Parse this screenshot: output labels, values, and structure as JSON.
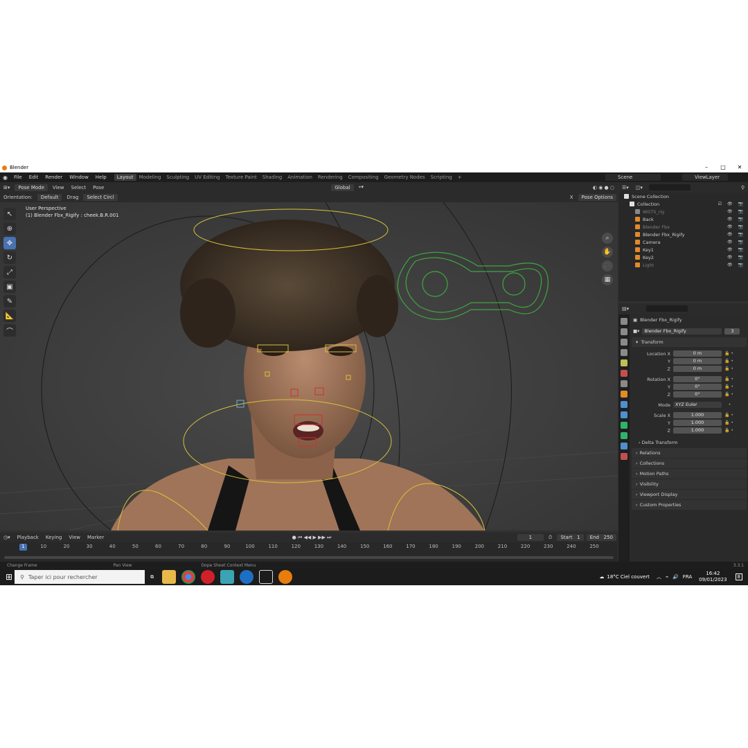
{
  "window": {
    "title": "Blender",
    "version": "3.3.1"
  },
  "menu": [
    "File",
    "Edit",
    "Render",
    "Window",
    "Help"
  ],
  "workspaces": [
    "Layout",
    "Modeling",
    "Sculpting",
    "UV Editing",
    "Texture Paint",
    "Shading",
    "Animation",
    "Rendering",
    "Compositing",
    "Geometry Nodes",
    "Scripting"
  ],
  "active_workspace": "Layout",
  "scene": "Scene",
  "view_layer": "ViewLayer",
  "viewport": {
    "mode": "Pose Mode",
    "view_menu": "View",
    "select_menu": "Select",
    "pose_menu": "Pose",
    "transform_space": "Global",
    "orientation_label": "Orientation:",
    "orientation_value": "Default",
    "drag_label": "Drag",
    "drag_value": "Select Circl",
    "pose_options": "Pose Options",
    "perspective": "User Perspective",
    "active_bone": "(1) Blender Fbx_Rigify : cheek.B.R.001",
    "axis_x": "X"
  },
  "timeline": {
    "playback": "Playback",
    "keying": "Keying",
    "view": "View",
    "marker": "Marker",
    "current_frame": "1",
    "start_label": "Start",
    "start": "1",
    "end_label": "End",
    "end": "250",
    "frame_ticks": [
      "1",
      "10",
      "20",
      "30",
      "40",
      "50",
      "60",
      "70",
      "80",
      "90",
      "100",
      "110",
      "120",
      "130",
      "140",
      "150",
      "160",
      "170",
      "180",
      "190",
      "200",
      "210",
      "220",
      "230",
      "240",
      "250"
    ]
  },
  "status_bar": {
    "left": "Change Frame",
    "middle": "Pan View",
    "right": "Dope Sheet Context Menu"
  },
  "outliner": {
    "root": "Scene Collection",
    "collection": "Collection",
    "items": [
      {
        "name": "WGTS_rig",
        "dim": true
      },
      {
        "name": "Back",
        "dim": false
      },
      {
        "name": "Blender Fbx",
        "dim": true
      },
      {
        "name": "Blender Fbx_Rigify",
        "dim": false
      },
      {
        "name": "Camera",
        "dim": false
      },
      {
        "name": "Key1",
        "dim": false
      },
      {
        "name": "Key2",
        "dim": false
      },
      {
        "name": "Light",
        "dim": true
      }
    ]
  },
  "properties": {
    "object_header": "Blender Fbx_Rigify",
    "object_name": "Blender Fbx_Rigify",
    "users": "3",
    "transform_label": "Transform",
    "location_label": "Location X",
    "location": [
      "0 m",
      "0 m",
      "0 m"
    ],
    "rotation_label": "Rotation X",
    "rotation": [
      "0°",
      "0°",
      "0°"
    ],
    "mode_label": "Mode",
    "mode_value": "XYZ Euler",
    "scale_label": "Scale X",
    "scale": [
      "1.000",
      "1.000",
      "1.000"
    ],
    "axis_y": "Y",
    "axis_z": "Z",
    "delta_transform": "Delta Transform",
    "panels": [
      "Relations",
      "Collections",
      "Motion Paths",
      "Visibility",
      "Viewport Display",
      "Custom Properties"
    ]
  },
  "taskbar": {
    "search_placeholder": "Taper ici pour rechercher",
    "weather": "18°C Ciel couvert",
    "language": "FRA",
    "time": "16:42",
    "date": "09/01/2023",
    "notifications": "8"
  }
}
